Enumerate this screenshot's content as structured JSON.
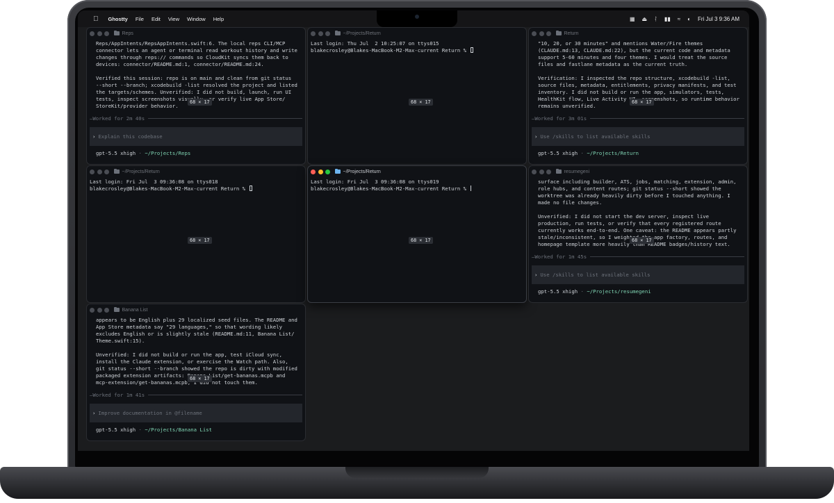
{
  "menubar": {
    "apple": "",
    "app_name": "Ghostty",
    "items": [
      "File",
      "Edit",
      "View",
      "Window",
      "Help"
    ],
    "clock": "Fri Jul 3  9:36 AM"
  },
  "size_overlay": "68 × 17",
  "panes": {
    "reps": {
      "title": "Reps",
      "lines": [
        "Reps/AppIntents/RepsAppIntents.swift:6. The local reps CLI/MCP",
        "connector lets an agent or terminal read workout history and write",
        "changes through reps:// commands so CloudKit syncs them back to",
        "devices: connector/README.md:1, connector/README.md:24.",
        "Verified this session: repo is on main and clean from git status",
        "--short --branch; xcodebuild -list resolved the project and listed",
        "the targets/schemes. Unverified: I did not build, launch, run UI",
        "tests, inspect screenshots visually, or verify live App Store/",
        "StoreKit/provider behavior."
      ],
      "worked": "Worked for 2m 40s",
      "prompt": "Explain this codebase",
      "model": "gpt-5.5 xhigh",
      "sep": "·",
      "path": "~/Projects/Reps"
    },
    "return_top": {
      "title": "~/Projects/Return",
      "login": "Last login: Thu Jul  2 10:25:07 on ttys015",
      "prompt_line": "blakecrosley@Blakes-MacBook-M2-Max-current Return % "
    },
    "return_codex": {
      "title": "Return",
      "lines": [
        "\"10, 20, or 30 minutes\" and mentions Water/Fire themes",
        "(CLAUDE.md:13, CLAUDE.md:22), but the current code and metadata",
        "support 5-60 minutes and four themes. I would treat the source",
        "files and fastlane metadata as the current truth.",
        "Verification: I inspected the repo structure, xcodebuild -list,",
        "source files, metadata, entitlements, privacy manifests, and test",
        "inventory. I did not build or run the app, simulators, tests,",
        "HealthKit flow, Live Activity UI, screenshots, so runtime behavior",
        "remains unverified."
      ],
      "worked": "Worked for 3m 01s",
      "prompt": "Use /skills to list available skills",
      "model": "gpt-5.5 xhigh",
      "sep": "·",
      "path": "~/Projects/Return"
    },
    "return_mid_left": {
      "title": "~/Projects/Return",
      "login": "Last login: Fri Jul  3 09:36:08 on ttys018",
      "prompt_line": "blakecrosley@Blakes-MacBook-M2-Max-current Return % "
    },
    "return_mid_center": {
      "title": "~/Projects/Return",
      "login": "Last login: Fri Jul  3 09:36:08 on ttys019",
      "prompt_line": "blakecrosley@Blakes-MacBook-M2-Max-current Return % "
    },
    "resumegeni": {
      "title": "resumegeni",
      "lines": [
        "surface including builder, ATS, jobs, matching, extension, admin,",
        "role hubs, and content routes; git status --short showed the",
        "worktree was already heavily dirty before I touched anything. I",
        "made no file changes.",
        "Unverified: I did not start the dev server, inspect live",
        "production, run tests, or verify that every registered route",
        "currently works end-to-end. One caveat: the README appears partly",
        "stale/inconsistent, so I weighted the app factory, routes, and",
        "homepage template more heavily than README badges/history text."
      ],
      "worked": "Worked for 1m 45s",
      "prompt": "Use /skills to list available skills",
      "model": "gpt-5.5 xhigh",
      "sep": "·",
      "path": "~/Projects/resumegeni"
    },
    "banana": {
      "title": "Banana List",
      "lines": [
        "appears to be English plus 29 localized seed files. The README and",
        "App Store metadata say \"29 languages,\" so that wording likely",
        "excludes English or is slightly stale (README.md:11, Banana List/",
        "Theme.swift:15).",
        "Unverified: I did not build or run the app, test iCloud sync,",
        "install the Claude extension, or exercise the Watch path. Also,",
        "git status --short --branch showed the repo is dirty with modified",
        "packaged extension artifacts: Banana List/get-bananas.mcpb and",
        "mcp-extension/get-bananas.mcpb, I did not touch them."
      ],
      "worked": "Worked for 1m 41s",
      "prompt": "Improve documentation in @filename",
      "model": "gpt-5.5 xhigh",
      "sep": "·",
      "path": "~/Projects/Banana List"
    }
  },
  "colors": {
    "terminal_bg": "#101216",
    "accent_green": "#7fd3b2",
    "close": "#ff5f57",
    "minimize": "#febc2e",
    "zoom": "#28c840"
  }
}
